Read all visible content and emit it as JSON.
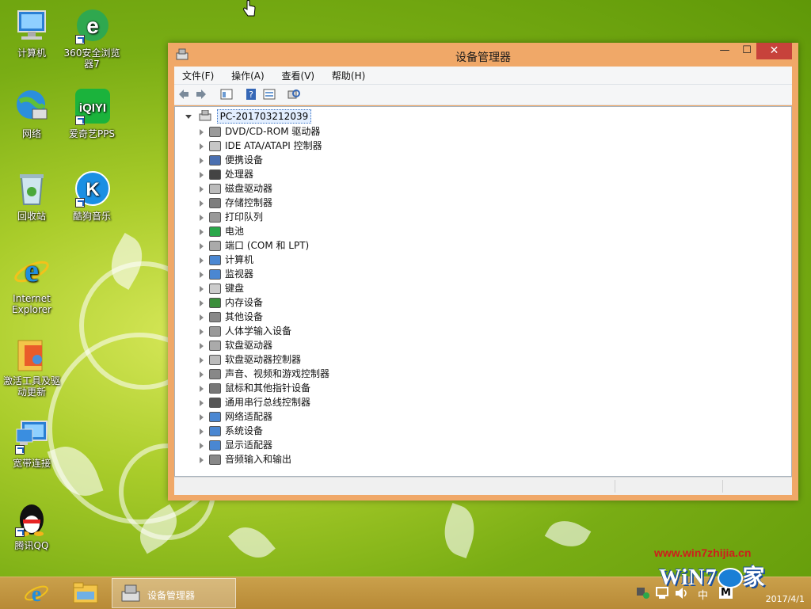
{
  "desktop": {
    "icons": [
      {
        "label": "计算机"
      },
      {
        "label": "360安全浏览器7"
      },
      {
        "label": "网络"
      },
      {
        "label": "爱奇艺PPS"
      },
      {
        "label": "回收站"
      },
      {
        "label": "酷狗音乐"
      },
      {
        "label": "Internet Explorer"
      },
      {
        "label": "激活工具及驱动更新"
      },
      {
        "label": "宽带连接"
      },
      {
        "label": "腾讯QQ"
      }
    ]
  },
  "window": {
    "title": "设备管理器",
    "minimize_label": "—",
    "maximize_label": "☐",
    "close_label": "✕",
    "menu": [
      "文件(F)",
      "操作(A)",
      "查看(V)",
      "帮助(H)"
    ],
    "toolbar_icons": [
      "back-icon",
      "forward-icon",
      "properties-icon",
      "help-icon",
      "view-icon",
      "scan-hardware-icon"
    ],
    "tree": {
      "root": "PC-201703212039",
      "items": [
        "DVD/CD-ROM 驱动器",
        "IDE ATA/ATAPI 控制器",
        "便携设备",
        "处理器",
        "磁盘驱动器",
        "存储控制器",
        "打印队列",
        "电池",
        "端口 (COM 和 LPT)",
        "计算机",
        "监视器",
        "键盘",
        "内存设备",
        "其他设备",
        "人体学输入设备",
        "软盘驱动器",
        "软盘驱动器控制器",
        "声音、视频和游戏控制器",
        "鼠标和其他指针设备",
        "通用串行总线控制器",
        "网络适配器",
        "系统设备",
        "显示适配器",
        "音频输入和输出"
      ]
    }
  },
  "taskbar": {
    "active_task": "设备管理器",
    "ime_label": "中",
    "ime_mode": "M",
    "clock_date": "2017/4/1"
  },
  "watermark": {
    "url": "www.win7zhijia.cn",
    "logo_text_left": "WiN7",
    "logo_text_right": "家"
  },
  "colors": {
    "window_frame": "#f0a868",
    "close_button": "#c7423b",
    "taskbar": "#b88a36",
    "desktop": "#8bbd1c"
  }
}
